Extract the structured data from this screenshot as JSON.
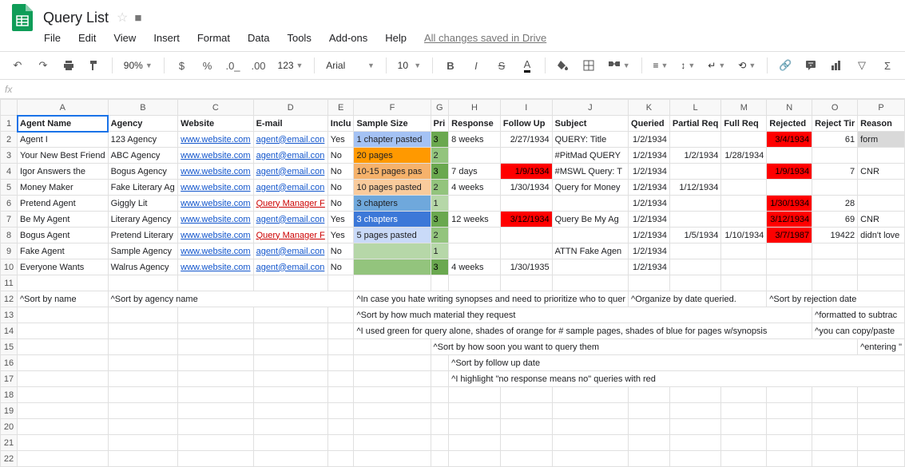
{
  "title": "Query List",
  "saved": "All changes saved in Drive",
  "menus": [
    "File",
    "Edit",
    "View",
    "Insert",
    "Format",
    "Data",
    "Tools",
    "Add-ons",
    "Help"
  ],
  "zoom": "90%",
  "font": "Arial",
  "fontsize": "10",
  "cols": [
    "",
    "A",
    "B",
    "C",
    "D",
    "E",
    "F",
    "G",
    "H",
    "I",
    "J",
    "K",
    "L",
    "M",
    "N",
    "O",
    "P"
  ],
  "headers": {
    "A": "Agent Name",
    "B": "Agency",
    "C": "Website",
    "D": "E-mail",
    "E": "Inclu",
    "F": "Sample Size",
    "G": "Pri",
    "H": "Response",
    "I": "Follow Up",
    "J": "Subject",
    "K": "Queried",
    "L": "Partial Req",
    "M": "Full Req",
    "N": "Rejected",
    "O": "Reject Tir",
    "P": "Reason"
  },
  "rows": [
    {
      "n": 2,
      "A": "Agent I",
      "B": "123 Agency",
      "C": "www.website.com",
      "D": "agent@email.con",
      "E": "Yes",
      "F": "1 chapter pasted",
      "Fcls": "blue3",
      "G": "3",
      "Gcls": "green1",
      "H": "8 weeks",
      "I": "2/27/1934",
      "J": "QUERY: Title",
      "K": "1/2/1934",
      "L": "",
      "M": "",
      "N": "3/4/1934",
      "Ncls": "red",
      "O": "61",
      "P": "form",
      "Pcls": "gray"
    },
    {
      "n": 3,
      "A": "Your New Best Friend",
      "B": "ABC Agency",
      "C": "www.website.com",
      "D": "agent@email.con",
      "E": "No",
      "F": "20 pages",
      "Fcls": "orange1",
      "G": "2",
      "Gcls": "green2",
      "H": "",
      "I": "",
      "J": "#PitMad QUERY",
      "K": "1/2/1934",
      "L": "1/2/1934",
      "M": "1/28/1934",
      "N": "",
      "O": "",
      "P": ""
    },
    {
      "n": 4,
      "A": "Igor Answers the",
      "B": "Bogus Agency",
      "C": "www.website.com",
      "D": "agent@email.con",
      "E": "No",
      "F": "10-15 pages pas",
      "Fcls": "orange2",
      "G": "3",
      "Gcls": "green1",
      "H": "7 days",
      "I": "1/9/1934",
      "Icls": "red",
      "J": "#MSWL Query: T",
      "K": "1/2/1934",
      "L": "",
      "M": "",
      "N": "1/9/1934",
      "Ncls": "red",
      "O": "7",
      "P": "CNR"
    },
    {
      "n": 5,
      "A": "Money Maker",
      "B": "Fake Literary Ag",
      "C": "www.website.com",
      "D": "agent@email.con",
      "E": "No",
      "F": "10 pages pasted",
      "Fcls": "orange3",
      "G": "2",
      "Gcls": "green2",
      "H": "4 weeks",
      "I": "1/30/1934",
      "J": "Query for Money",
      "K": "1/2/1934",
      "L": "1/12/1934",
      "M": "",
      "N": "",
      "O": "",
      "P": ""
    },
    {
      "n": 6,
      "A": "Pretend Agent",
      "B": "Giggly Lit",
      "C": "www.website.com",
      "D": "Query Manager F",
      "Dcls": "linkred",
      "E": "No",
      "F": "3 chapters",
      "Fcls": "blue2",
      "G": "1",
      "Gcls": "green3",
      "H": "",
      "I": "",
      "J": "",
      "K": "1/2/1934",
      "L": "",
      "M": "",
      "N": "1/30/1934",
      "Ncls": "red",
      "O": "28",
      "P": ""
    },
    {
      "n": 7,
      "A": "Be My Agent",
      "B": "Literary Agency",
      "C": "www.website.com",
      "D": "agent@email.con",
      "E": "Yes",
      "F": "3 chapters",
      "Fcls": "blue1",
      "G": "3",
      "Gcls": "green1",
      "H": "12 weeks",
      "I": "3/12/1934",
      "Icls": "red",
      "J": "Query Be My Ag",
      "K": "1/2/1934",
      "L": "",
      "M": "",
      "N": "3/12/1934",
      "Ncls": "red",
      "O": "69",
      "P": "CNR"
    },
    {
      "n": 8,
      "A": "Bogus Agent",
      "B": "Pretend Literary",
      "C": "www.website.com",
      "D": "Query Manager F",
      "Dcls": "linkred",
      "E": "Yes",
      "F": "5 pages pasted",
      "Fcls": "blue4",
      "G": "2",
      "Gcls": "green2",
      "H": "",
      "I": "",
      "J": "",
      "K": "1/2/1934",
      "L": "1/5/1934",
      "M": "1/10/1934",
      "N": "3/7/1987",
      "Ncls": "red",
      "O": "19422",
      "P": "didn't love"
    },
    {
      "n": 9,
      "A": "Fake Agent",
      "B": "Sample Agency",
      "C": "www.website.com",
      "D": "agent@email.con",
      "E": "No",
      "F": "",
      "Fcls": "green3",
      "G": "1",
      "Gcls": "green3",
      "H": "",
      "I": "",
      "J": "ATTN Fake Agen",
      "K": "1/2/1934",
      "L": "",
      "M": "",
      "N": "",
      "O": "",
      "P": ""
    },
    {
      "n": 10,
      "A": "Everyone Wants",
      "B": "Walrus Agency",
      "C": "www.website.com",
      "D": "agent@email.con",
      "E": "No",
      "F": "",
      "Fcls": "green2",
      "G": "3",
      "Gcls": "green1",
      "H": "4 weeks",
      "I": "1/30/1935",
      "J": "",
      "K": "1/2/1934",
      "L": "",
      "M": "",
      "N": "",
      "O": "",
      "P": ""
    }
  ],
  "notes": {
    "12": {
      "A": "^Sort by name",
      "B": "^Sort by agency name",
      "F": "^In case you hate writing synopses and need to prioritize who to quer",
      "K": "^Organize by date queried.",
      "N": "^Sort by rejection date"
    },
    "13": {
      "F": "^Sort by how much material they request",
      "O": "^formatted to subtrac"
    },
    "14": {
      "F": "^I used green for query alone, shades of orange for # sample pages, shades of blue for pages w/synopsis",
      "O": "^you can copy/paste"
    },
    "15": {
      "G": "^Sort by how soon you want to query them",
      "P": "^entering \""
    },
    "16": {
      "H": "^Sort by follow up date"
    },
    "17": {
      "H": "^I highlight \"no response means no\" queries with red"
    }
  }
}
